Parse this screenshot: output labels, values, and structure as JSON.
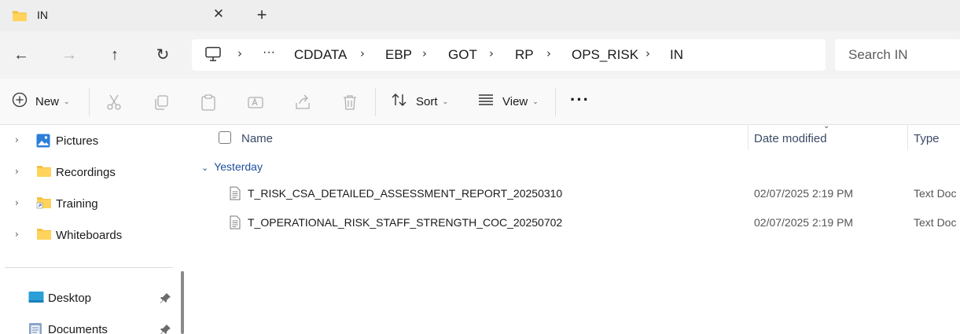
{
  "tab": {
    "title": "IN",
    "close_glyph": "✕",
    "new_tab_glyph": "+"
  },
  "nav": {
    "back_glyph": "←",
    "forward_glyph": "→",
    "up_glyph": "↑",
    "refresh_glyph": "↻"
  },
  "address": {
    "overflow": "···",
    "separator": "›",
    "crumbs": [
      "CDDATA",
      "EBP",
      "GOT",
      "RP",
      "OPS_RISK",
      "IN"
    ]
  },
  "search": {
    "placeholder": "Search IN"
  },
  "toolbar": {
    "new_label": "New",
    "sort_label": "Sort",
    "view_label": "View",
    "more_glyph": "···",
    "dropdown_glyph": "⌄"
  },
  "sidebar": {
    "tree_items": [
      {
        "label": "Pictures",
        "icon": "pictures-icon"
      },
      {
        "label": "Recordings",
        "icon": "folder-icon"
      },
      {
        "label": "Training",
        "icon": "shortcut-folder-icon"
      },
      {
        "label": "Whiteboards",
        "icon": "folder-icon"
      }
    ],
    "quick_access": [
      {
        "label": "Desktop",
        "icon": "desktop-icon",
        "pinned": true
      },
      {
        "label": "Documents",
        "icon": "documents-icon",
        "pinned": true
      }
    ],
    "expand_glyph": "›"
  },
  "list": {
    "columns": {
      "name": "Name",
      "date_modified": "Date modified",
      "type": "Type"
    },
    "sort_glyph": "⌄",
    "group_chevron": "⌄",
    "group_label": "Yesterday",
    "files": [
      {
        "name": "T_RISK_CSA_DETAILED_ASSESSMENT_REPORT_20250310",
        "date": "02/07/2025 2:19 PM",
        "type": "Text Doc"
      },
      {
        "name": "T_OPERATIONAL_RISK_STAFF_STRENGTH_COC_20250702",
        "date": "02/07/2025 2:19 PM",
        "type": "Text Doc"
      }
    ]
  },
  "colors": {
    "accent": "#1f4e9a",
    "folder": "#f4c142",
    "tabbar": "#eeeeee",
    "addressrow": "#f3f3f3"
  }
}
